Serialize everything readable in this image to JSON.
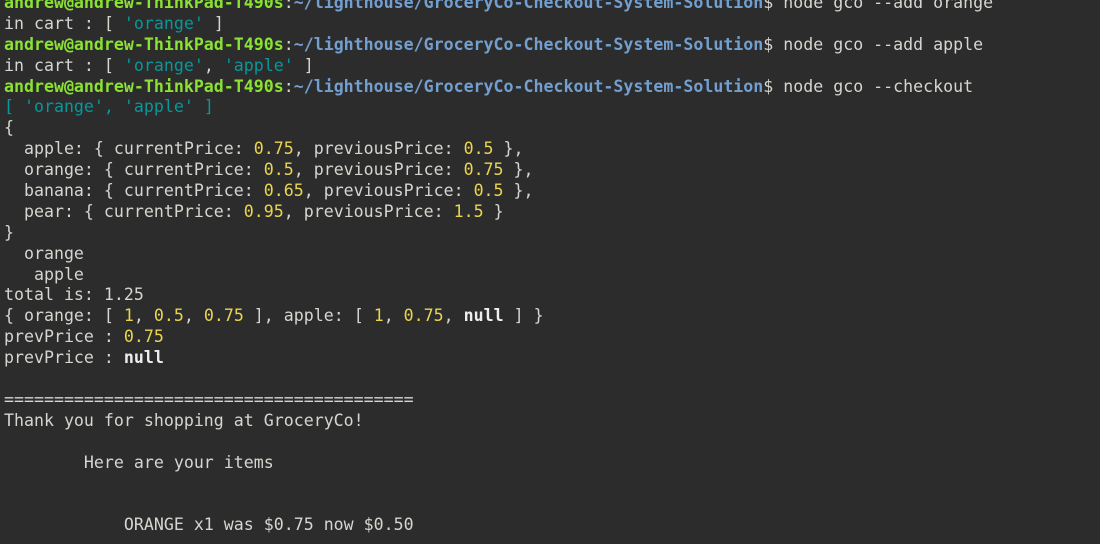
{
  "terminal": {
    "prompt": {
      "user_host": "andrew@andrew-ThinkPad-T490s",
      "sep": ":",
      "path": "~/lighthouse/GroceryCo-Checkout-System-Solution",
      "dollar": "$ "
    },
    "commands": [
      "node gco --add orange",
      "node gco --add apple",
      "node gco --checkout"
    ],
    "colors": {
      "background": "#2c2c2c",
      "prompt_user": "#8ae234",
      "prompt_path": "#729fcf",
      "string": "#06989a",
      "number": "#e9d54e",
      "text": "#d3d7cf"
    },
    "out1": {
      "prefix": "in cart : [ ",
      "item1": "'orange'",
      "suffix": " ]"
    },
    "out2": {
      "prefix": "in cart : [ ",
      "item1": "'orange'",
      "comma": ", ",
      "item2": "'apple'",
      "suffix": " ]"
    },
    "out3": {
      "cart": {
        "open": "[ ",
        "item1": "'orange'",
        "comma": ", ",
        "item2": "'apple'",
        "close": " ]"
      },
      "brace_open": "{",
      "prices": [
        {
          "name": "  apple: { currentPrice: ",
          "current": "0.75",
          "mid": ", previousPrice: ",
          "previous": "0.5",
          "end": " },"
        },
        {
          "name": "  orange: { currentPrice: ",
          "current": "0.5",
          "mid": ", previousPrice: ",
          "previous": "0.75",
          "end": " },"
        },
        {
          "name": "  banana: { currentPrice: ",
          "current": "0.65",
          "mid": ", previousPrice: ",
          "previous": "0.5",
          "end": " },"
        },
        {
          "name": "  pear: { currentPrice: ",
          "current": "0.95",
          "mid": ", previousPrice: ",
          "previous": "1.5",
          "end": " }"
        }
      ],
      "brace_close": "}",
      "item_orange": "  orange",
      "item_apple": "   apple",
      "total": "total is: 1.25",
      "summary": {
        "p1": "{ orange: [ ",
        "o1": "1",
        "c1": ", ",
        "o2": "0.5",
        "c2": ", ",
        "o3": "0.75",
        "p2": " ], apple: [ ",
        "a1": "1",
        "c3": ", ",
        "a2": "0.75",
        "c4": ", ",
        "a3": "null",
        "p3": " ] }"
      },
      "prev1_label": "prevPrice : ",
      "prev1_value": "0.75",
      "prev2_label": "prevPrice : ",
      "prev2_value": "null",
      "separator": "=========================================",
      "thanks": "Thank you for shopping at GroceryCo!",
      "items_header": "        Here are your items",
      "receipt_line": "            ORANGE x1 was $0.75 now $0.50"
    }
  }
}
